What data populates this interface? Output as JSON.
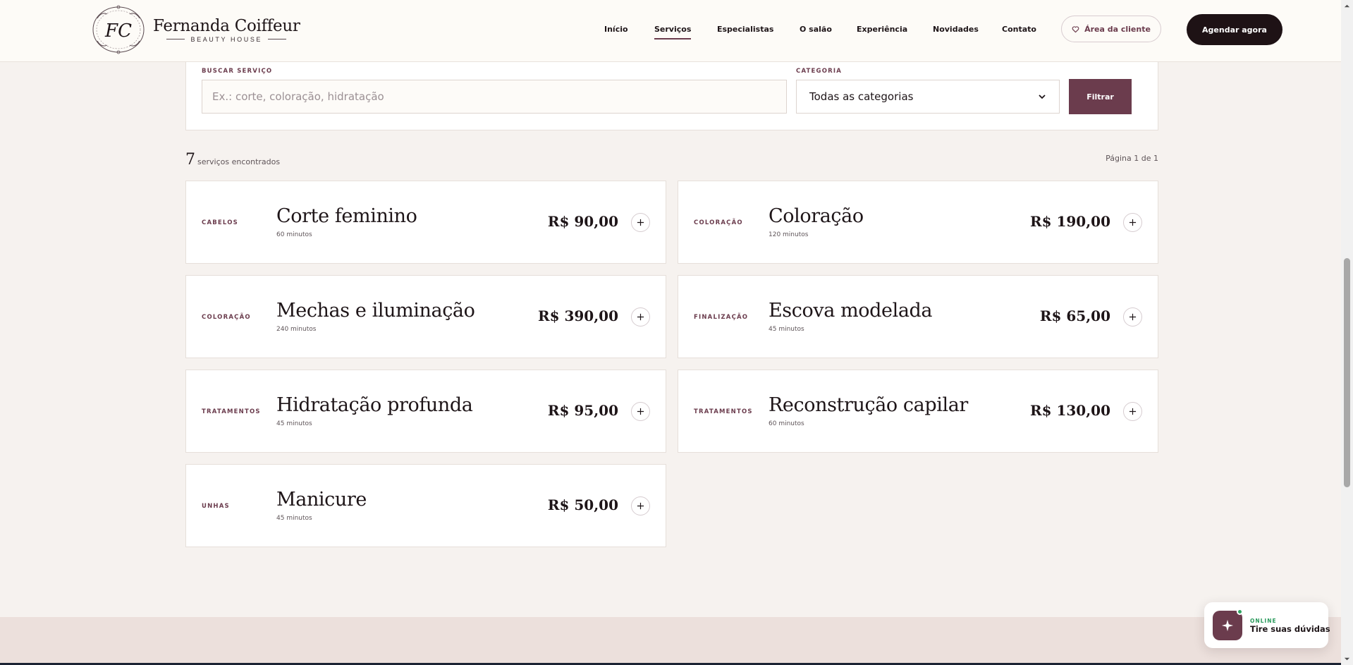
{
  "brand": {
    "name": "Fernanda Coiffeur",
    "tagline": "BEAUTY HOUSE",
    "monogram": "FC"
  },
  "nav": {
    "items": [
      {
        "label": "Início",
        "active": false
      },
      {
        "label": "Serviços",
        "active": true
      },
      {
        "label": "Especialistas",
        "active": false
      },
      {
        "label": "O salão",
        "active": false
      },
      {
        "label": "Experiência",
        "active": false
      },
      {
        "label": "Novidades",
        "active": false
      },
      {
        "label": "Contato",
        "active": false
      }
    ],
    "client_area": "Área da cliente",
    "book_now": "Agendar agora"
  },
  "filters": {
    "search_label": "BUSCAR SERVIÇO",
    "search_value": "",
    "search_placeholder": "Ex.: corte, coloração, hidratação",
    "category_label": "CATEGORIA",
    "category_selected": "Todas as categorias",
    "filter_button": "Filtrar"
  },
  "results": {
    "count": "7",
    "count_label": "serviços encontrados",
    "page_info": "Página 1 de 1"
  },
  "services": [
    {
      "category": "CABELOS",
      "name": "Corte feminino",
      "duration": "60 minutos",
      "price": "R$ 90,00"
    },
    {
      "category": "COLORAÇÃO",
      "name": "Coloração",
      "duration": "120 minutos",
      "price": "R$ 190,00"
    },
    {
      "category": "COLORAÇÃO",
      "name": "Mechas e iluminação",
      "duration": "240 minutos",
      "price": "R$ 390,00"
    },
    {
      "category": "FINALIZAÇÃO",
      "name": "Escova modelada",
      "duration": "45 minutos",
      "price": "R$ 65,00"
    },
    {
      "category": "TRATAMENTOS",
      "name": "Hidratação profunda",
      "duration": "45 minutos",
      "price": "R$ 95,00"
    },
    {
      "category": "TRATAMENTOS",
      "name": "Reconstrução capilar",
      "duration": "60 minutos",
      "price": "R$ 130,00"
    },
    {
      "category": "UNHAS",
      "name": "Manicure",
      "duration": "45 minutos",
      "price": "R$ 50,00"
    }
  ],
  "chat": {
    "status": "ONLINE",
    "text": "Tire suas dúvidas"
  },
  "colors": {
    "accent": "#6b3c4d",
    "dark": "#1e1215",
    "background": "#f6f2ef",
    "online": "#2fa563"
  }
}
